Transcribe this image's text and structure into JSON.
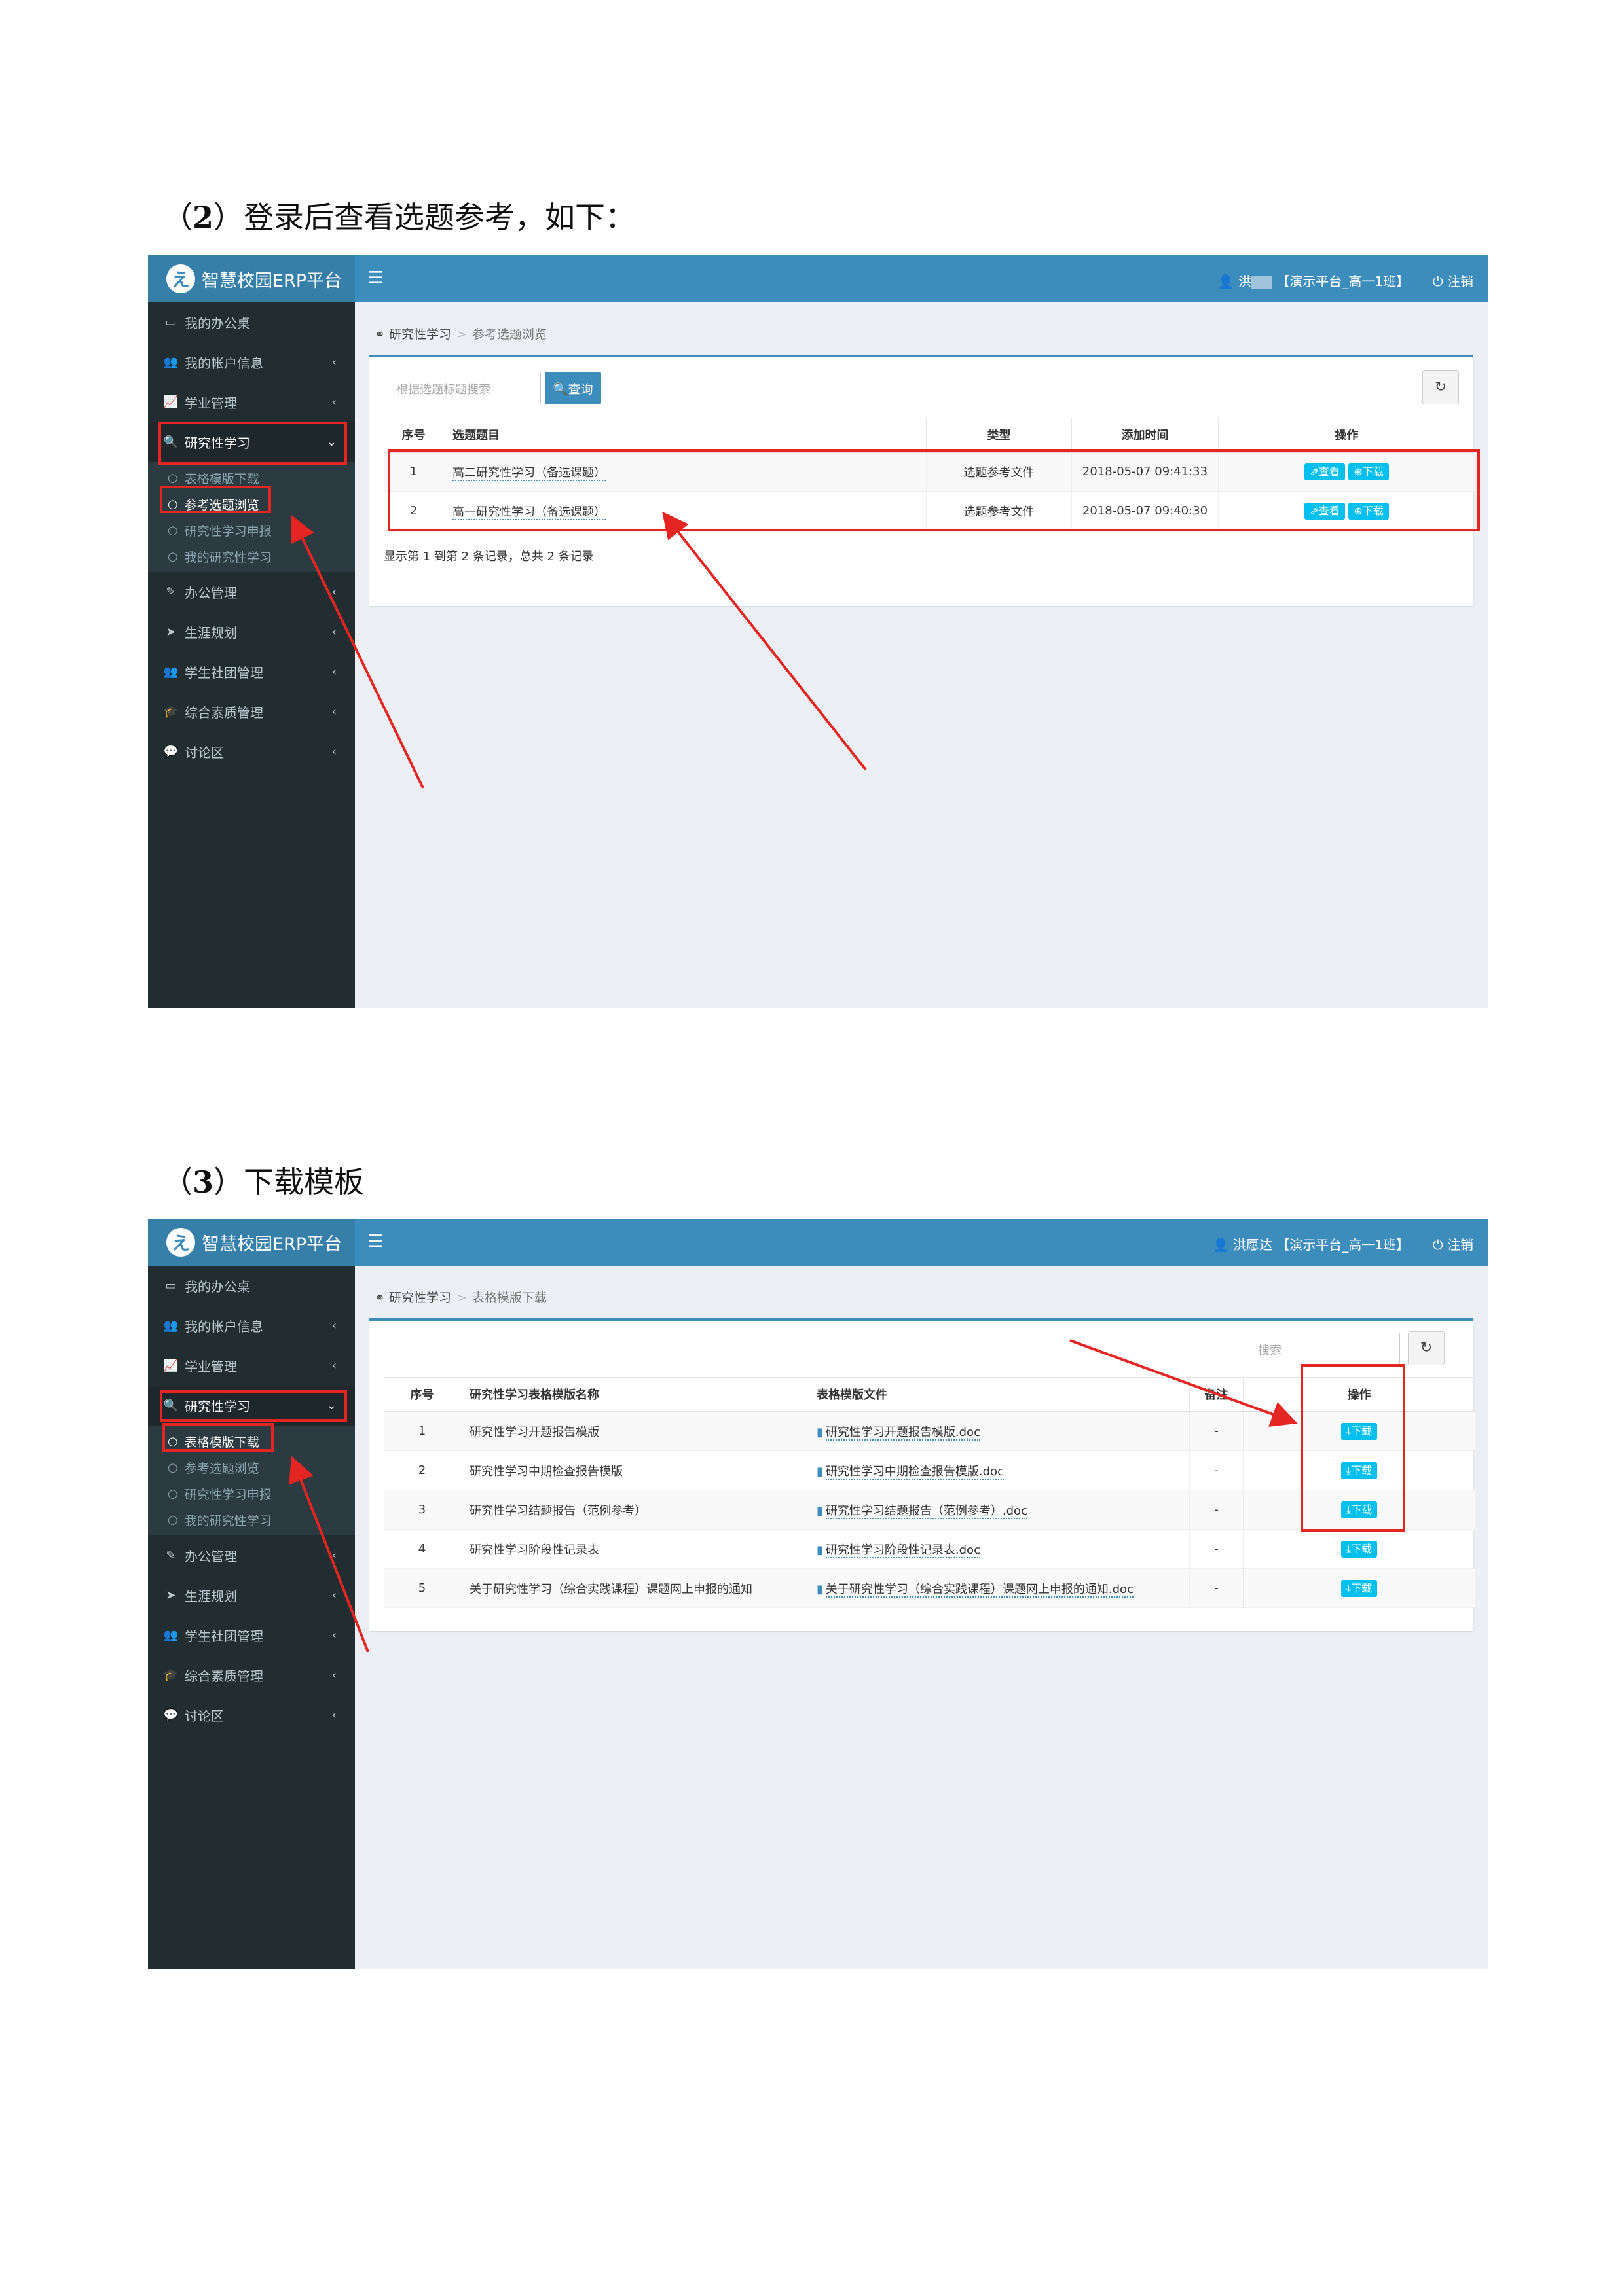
{
  "section2": {
    "caption_num": "2",
    "caption_text": "登录后查看选题参考，如下：",
    "app_title": "智慧校园ERP平台",
    "user_name": "洪",
    "user_context": "【演示平台_高一1班】",
    "logout": "注销",
    "menu": {
      "office": "我的办公桌",
      "account": "我的帐户信息",
      "academic": "学业管理",
      "research": "研究性学习",
      "sub_templates": "表格模版下载",
      "sub_reference": "参考选题浏览",
      "sub_apply": "研究性学习申报",
      "sub_mine": "我的研究性学习",
      "office_mgmt": "办公管理",
      "career": "生涯规划",
      "clubs": "学生社团管理",
      "quality": "综合素质管理",
      "discussion": "讨论区"
    },
    "breadcrumb": [
      "研究性学习",
      "参考选题浏览"
    ],
    "search_placeholder": "根据选题标题搜索",
    "query_button": "查询",
    "table": {
      "headers": [
        "序号",
        "选题题目",
        "类型",
        "添加时间",
        "操作"
      ],
      "rows": [
        {
          "no": "1",
          "title": "高二研究性学习（备选课题）",
          "type": "选题参考文件",
          "time": "2018-05-07 09:41:33"
        },
        {
          "no": "2",
          "title": "高一研究性学习（备选课题）",
          "type": "选题参考文件",
          "time": "2018-05-07 09:40:30"
        }
      ],
      "view_label": "查看",
      "download_label": "下载"
    },
    "summary": "显示第 1 到第 2 条记录，总共 2 条记录"
  },
  "section3": {
    "caption_num": "3",
    "caption_text": "下载模板",
    "app_title": "智慧校园ERP平台",
    "user_name": "洪愿达",
    "user_context": "【演示平台_高一1班】",
    "logout": "注销",
    "menu": {
      "office": "我的办公桌",
      "account": "我的帐户信息",
      "academic": "学业管理",
      "research": "研究性学习",
      "sub_templates": "表格模版下载",
      "sub_reference": "参考选题浏览",
      "sub_apply": "研究性学习申报",
      "sub_mine": "我的研究性学习",
      "office_mgmt": "办公管理",
      "career": "生涯规划",
      "clubs": "学生社团管理",
      "quality": "综合素质管理",
      "discussion": "讨论区"
    },
    "breadcrumb": [
      "研究性学习",
      "表格模版下载"
    ],
    "search_placeholder": "搜索",
    "table": {
      "headers": [
        "序号",
        "研究性学习表格模版名称",
        "表格模版文件",
        "备注",
        "操作"
      ],
      "rows": [
        {
          "no": "1",
          "name": "研究性学习开题报告模版",
          "file": "研究性学习开题报告模版.doc",
          "note": "-"
        },
        {
          "no": "2",
          "name": "研究性学习中期检查报告模版",
          "file": "研究性学习中期检查报告模版.doc",
          "note": "-"
        },
        {
          "no": "3",
          "name": "研究性学习结题报告（范例参考）",
          "file": "研究性学习结题报告（范例参考）.doc",
          "note": "-"
        },
        {
          "no": "4",
          "name": "研究性学习阶段性记录表",
          "file": "研究性学习阶段性记录表.doc",
          "note": "-"
        },
        {
          "no": "5",
          "name": "关于研究性学习（综合实践课程）课题网上申报的通知",
          "file": "关于研究性学习（综合实践课程）课题网上申报的通知.doc",
          "note": "-"
        }
      ],
      "download_label": "下载"
    }
  },
  "colors": {
    "topbar": "#3c8dbc",
    "sidebar": "#222d32",
    "annotation": "#e52521",
    "button": "#00c0ef"
  }
}
